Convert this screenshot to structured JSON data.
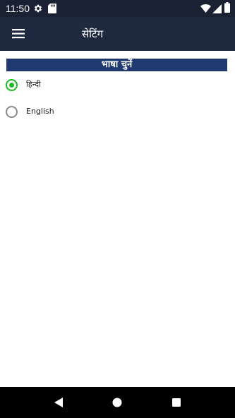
{
  "status_bar": {
    "time": "11:50",
    "icons": [
      "gear-icon",
      "sd-card-icon",
      "wifi-icon",
      "signal-icon",
      "battery-icon"
    ]
  },
  "app_bar": {
    "title": "सेटिंग",
    "menu_icon": "hamburger-menu-icon"
  },
  "settings": {
    "section_title": "भाषा चुनें",
    "options": [
      {
        "label": "हिन्दी",
        "selected": true
      },
      {
        "label": "English",
        "selected": false
      }
    ]
  },
  "nav_bar": {
    "icons": [
      "back-icon",
      "home-icon",
      "recents-icon"
    ]
  },
  "colors": {
    "status_bar_bg": "#1a2133",
    "app_bar_bg": "#1f2a40",
    "section_header_bg": "#203a70",
    "radio_selected": "#1fb924",
    "radio_unselected": "#8a8a8a",
    "nav_bar_bg": "#000000"
  }
}
